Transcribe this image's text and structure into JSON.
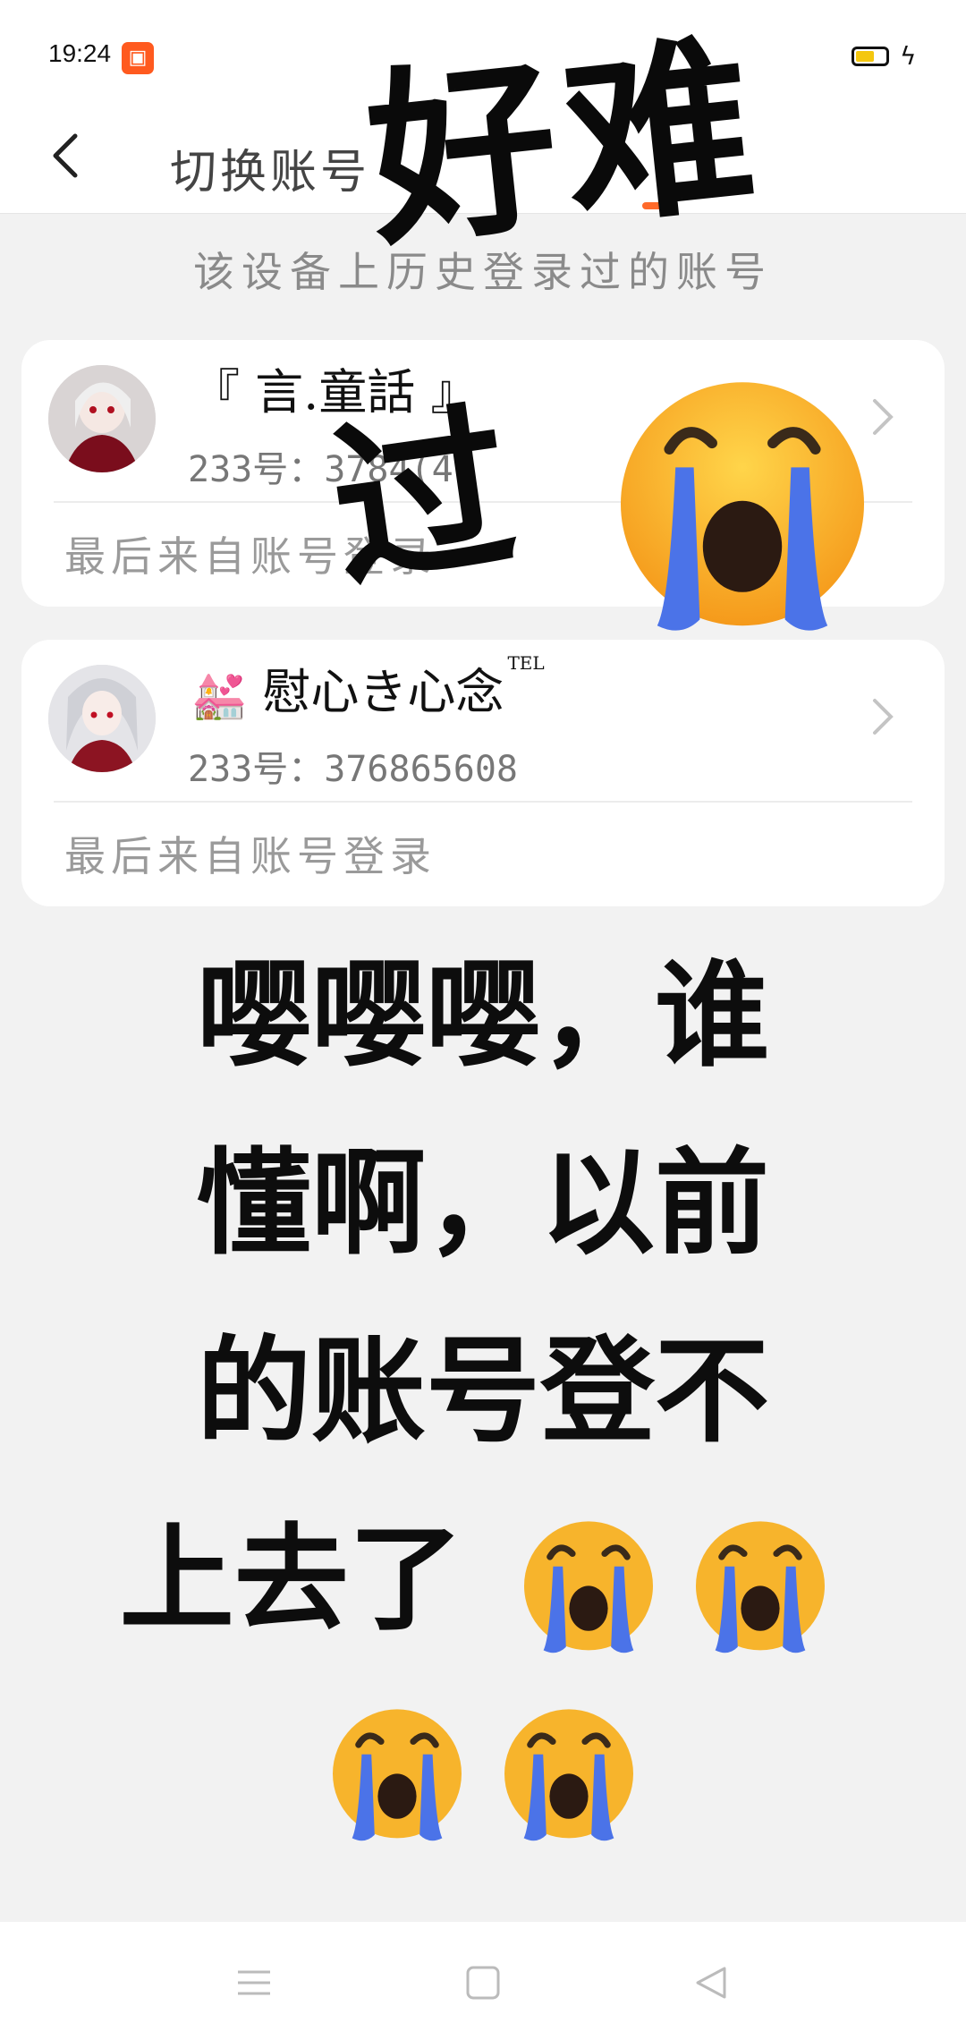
{
  "status_bar": {
    "time": "19:24",
    "app_icon": "kwai-badge",
    "battery_icon": "battery-icon",
    "charging_icon": "bolt-icon",
    "accent": "#ff5a1f"
  },
  "nav": {
    "title": "切换账号",
    "back_icon": "chevron-left-icon",
    "indicator_color": "#ff6a2a"
  },
  "section_title": "该设备上历史登录过的账号",
  "accounts": [
    {
      "name": "『 言.童話 』",
      "id_text": "233号：3784(4)",
      "note": "最后来自账号登录"
    },
    {
      "name_emoji": "💒",
      "name": "慰心き心念",
      "name_sup": "TEL",
      "id_text": "233号：376865608",
      "note": "最后来自账号登录"
    }
  ],
  "overlays": {
    "scribble_top": "好难",
    "scribble_card": "过"
  },
  "message": {
    "line1": "嘤嘤嘤，谁",
    "line2": "懂啊，以前",
    "line3": "的账号登不",
    "line4": "上去了"
  },
  "bottom_nav": {
    "menu_icon": "menu-icon",
    "home_icon": "square-icon",
    "back_icon": "triangle-back-icon"
  }
}
